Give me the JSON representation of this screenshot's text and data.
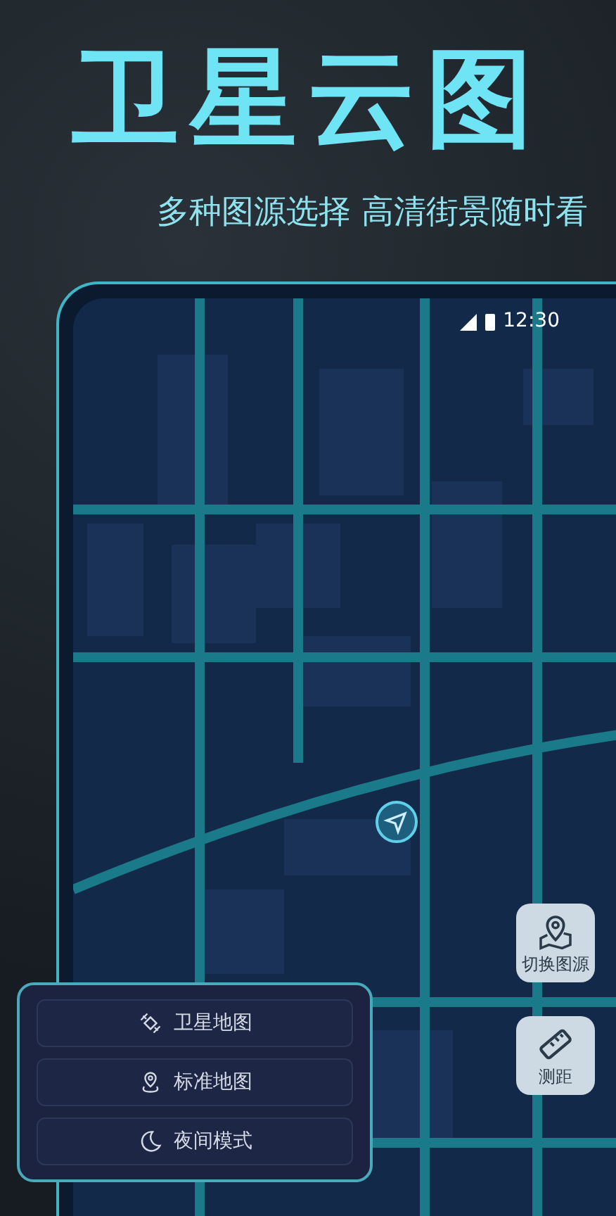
{
  "headline": "卫星云图",
  "subtitle": "多种图源选择 高清街景随时看",
  "status_bar": {
    "time": "12:30"
  },
  "map_tools": [
    {
      "kind": "source",
      "label": "切换图源"
    },
    {
      "kind": "measure",
      "label": "测距"
    }
  ],
  "map_modes": [
    {
      "kind": "satellite",
      "label": "卫星地图"
    },
    {
      "kind": "standard",
      "label": "标准地图"
    },
    {
      "kind": "night",
      "label": "夜间模式"
    }
  ]
}
